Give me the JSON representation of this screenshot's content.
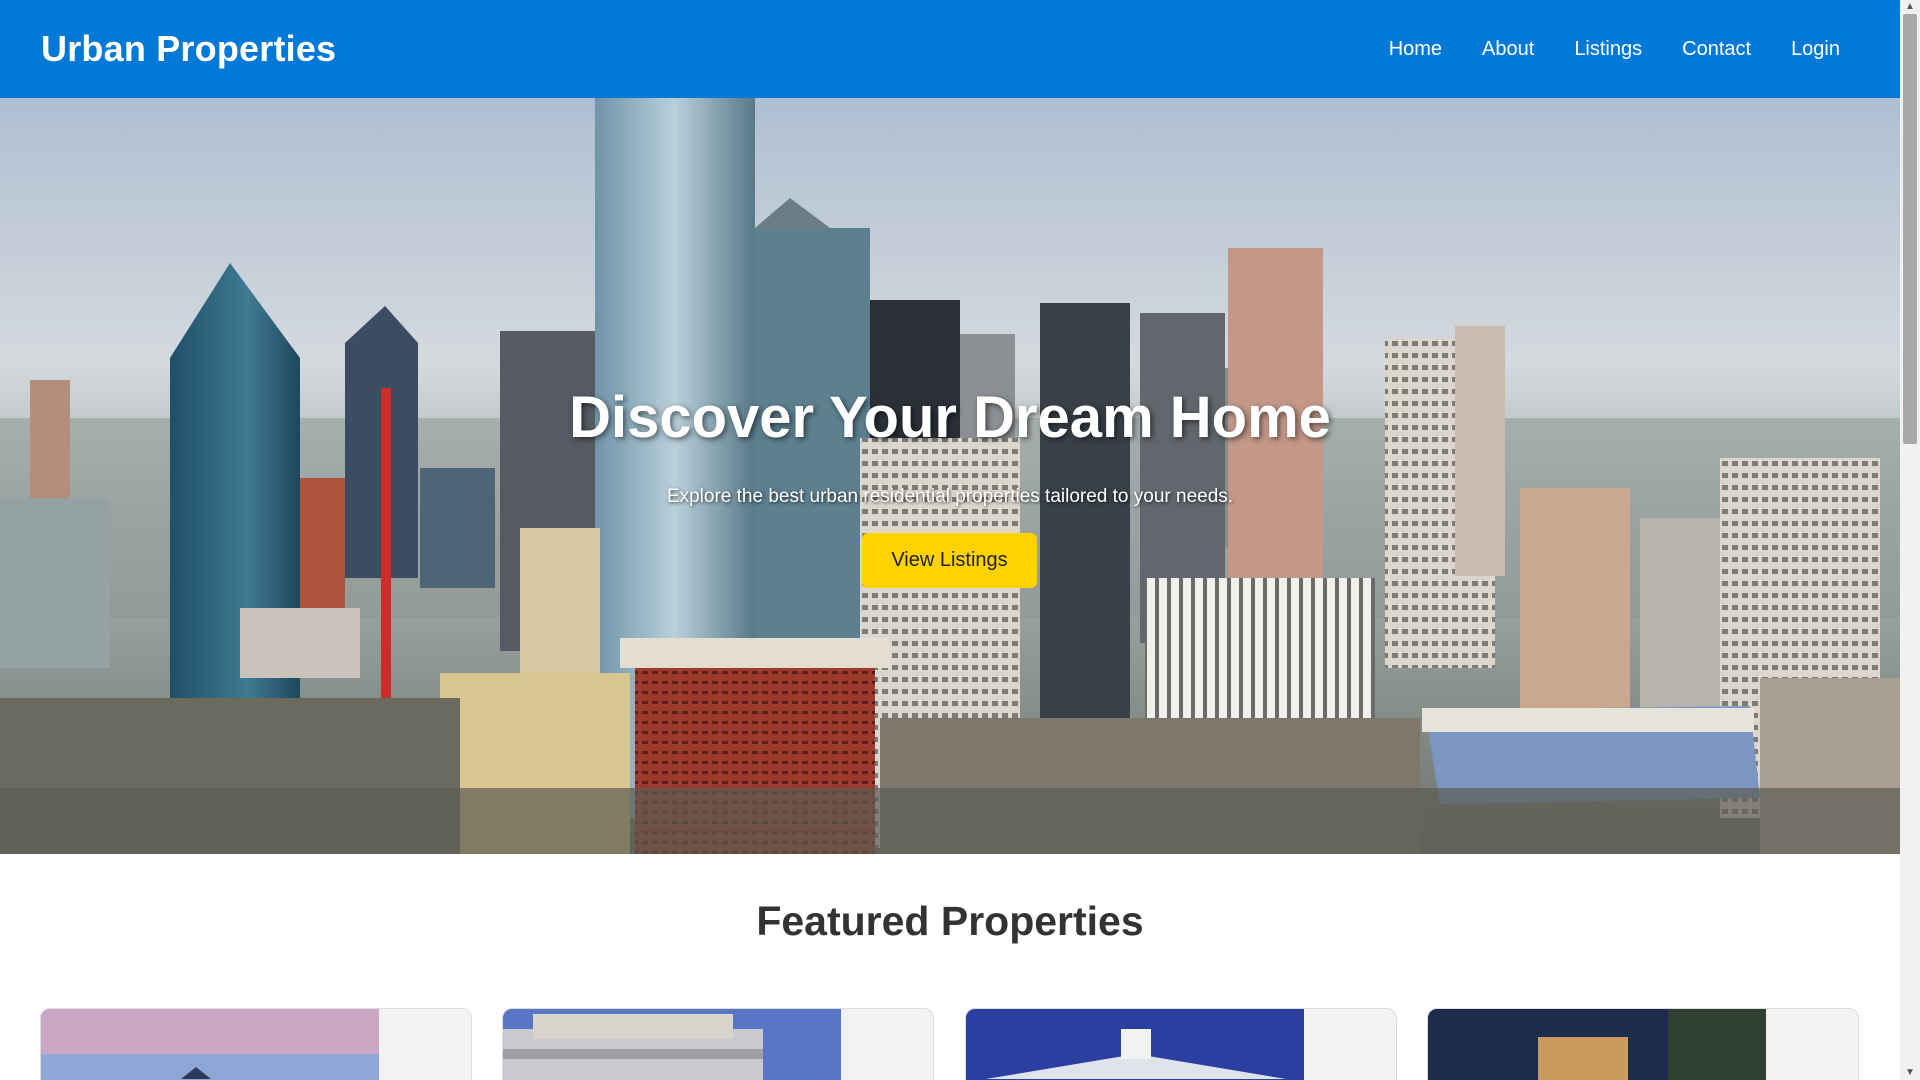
{
  "header": {
    "brand": "Urban Properties",
    "nav": [
      "Home",
      "About",
      "Listings",
      "Contact",
      "Login"
    ]
  },
  "hero": {
    "title": "Discover Your Dream Home",
    "subtitle": "Explore the best urban residential properties tailored to your needs.",
    "button": "View Listings"
  },
  "featured": {
    "title": "Featured Properties"
  },
  "colors": {
    "header": "#0278d7",
    "button": "#ffd200"
  },
  "icons": [
    "scroll-up-icon",
    "scroll-down-icon"
  ]
}
